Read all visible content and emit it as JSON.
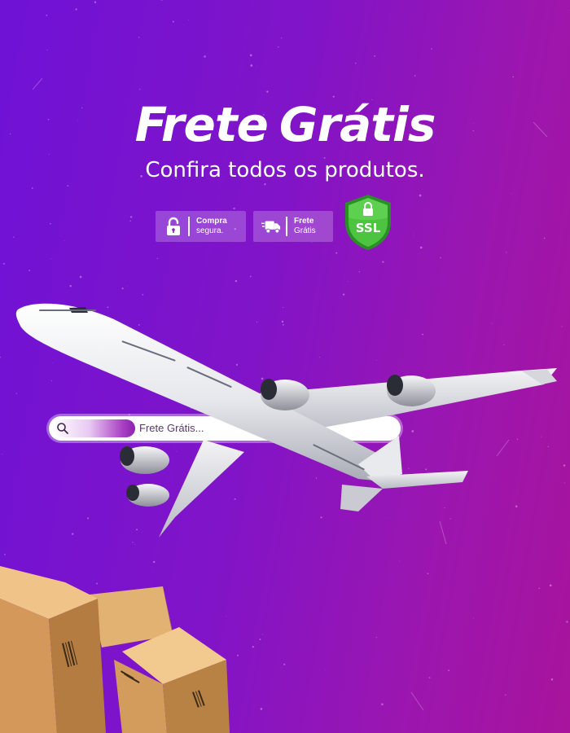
{
  "hero": {
    "title_word_1": "Frete",
    "title_word_2": "Grátis",
    "subtitle": "Confira todos os produtos."
  },
  "badges": [
    {
      "icon": "padlock-icon",
      "line1": "Compra",
      "line2": "segura."
    },
    {
      "icon": "delivery-truck-icon",
      "line1": "Frete",
      "line2": "Grátis"
    }
  ],
  "ssl_seal": {
    "text": "SSL",
    "icon": "shield-lock-icon"
  },
  "search": {
    "text": "Frete Grátis...",
    "icon": "search-icon"
  },
  "colors": {
    "background_left": "#6f12d6",
    "background_right": "#a8149c",
    "ssl_green": "#2fa52d",
    "text": "#ffffff"
  }
}
